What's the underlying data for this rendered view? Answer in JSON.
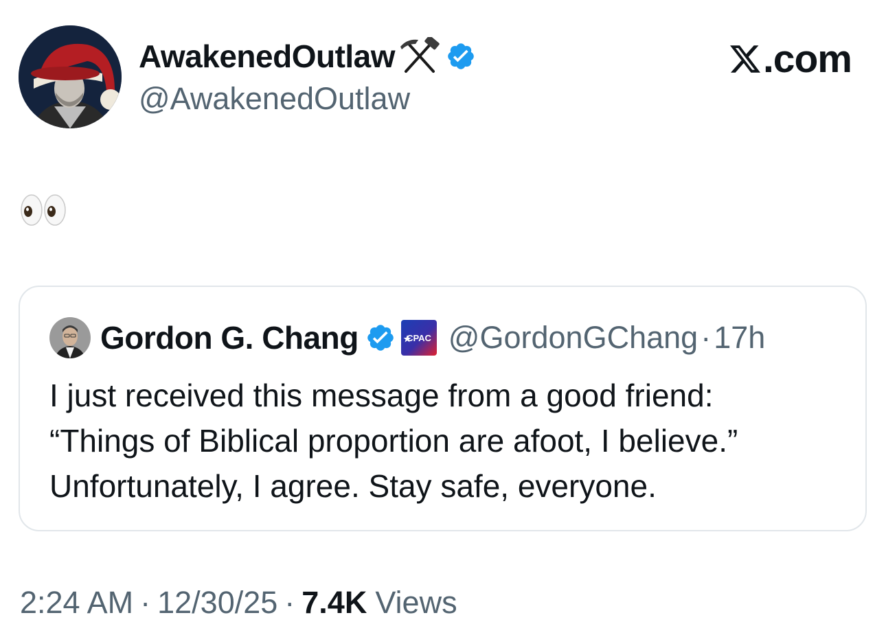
{
  "author": {
    "display_name": "AwakenedOutlaw",
    "handle": "@AwakenedOutlaw",
    "avatar": "avatar",
    "name_emoji": "hammer-and-pick-icon",
    "verified": true
  },
  "brand": {
    "logo_icon": "x-logo-icon",
    "text": ".com"
  },
  "tweet": {
    "body_emoji": "eyes-icon"
  },
  "quoted": {
    "display_name": "Gordon G. Chang",
    "handle": "@GordonGChang",
    "separator": "·",
    "time_ago": "17h",
    "affiliate_badge": "CPAC",
    "verified": true,
    "lines": [
      "I just received this message from a good friend:",
      "“Things of Biblical proportion are afoot, I believe.”",
      "Unfortunately, I agree. Stay safe, everyone."
    ]
  },
  "meta": {
    "time": "2:24 AM",
    "date": "12/30/25",
    "separator": "·",
    "views_count": "7.4K",
    "views_label": "Views"
  },
  "colors": {
    "verified_blue": "#1d9bf0",
    "secondary_text": "#536471",
    "primary_text": "#0f1419",
    "border": "#e1e6ea"
  }
}
